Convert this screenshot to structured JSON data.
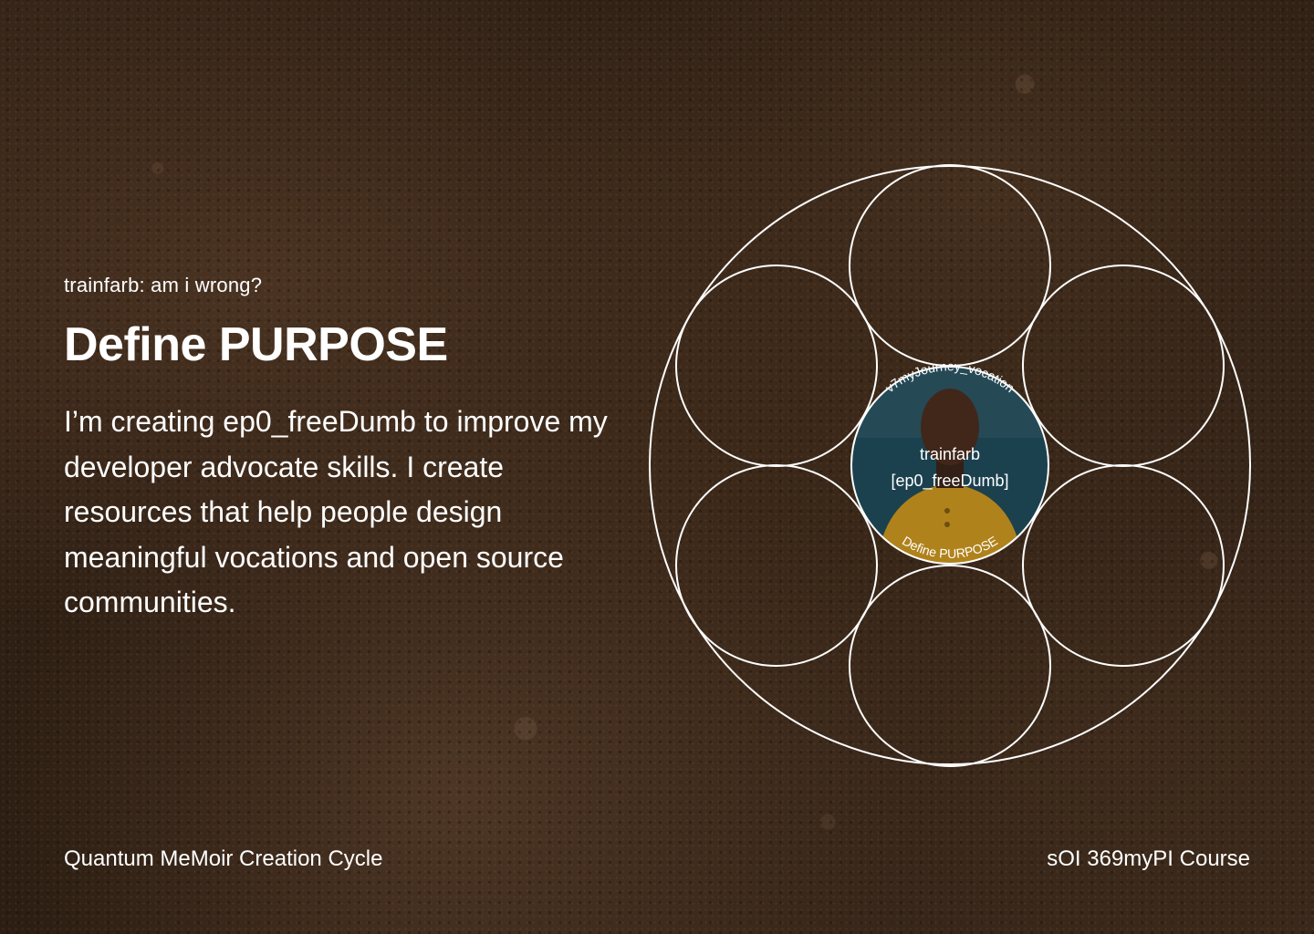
{
  "header": {
    "eyebrow": "trainfarb: am i wrong?",
    "title": "Define PURPOSE"
  },
  "main": {
    "body": "I’m creating ep0_freeDumb to improve my developer advocate skills. I create resources that help people design meaningful vocations and open source communities."
  },
  "avatar": {
    "arc_top": "v7myJourney_vocation",
    "name": "trainfarb",
    "tag": "[ep0_freeDumb]",
    "arc_bottom": "Define PURPOSE",
    "bg_color": "#1f4a5a",
    "shirt_color": "#c9951f"
  },
  "footer": {
    "left": "Quantum MeMoir Creation Cycle",
    "right": "sOI 369myPI Course"
  },
  "colors": {
    "text": "#ffffff",
    "outline": "#ffffff"
  }
}
